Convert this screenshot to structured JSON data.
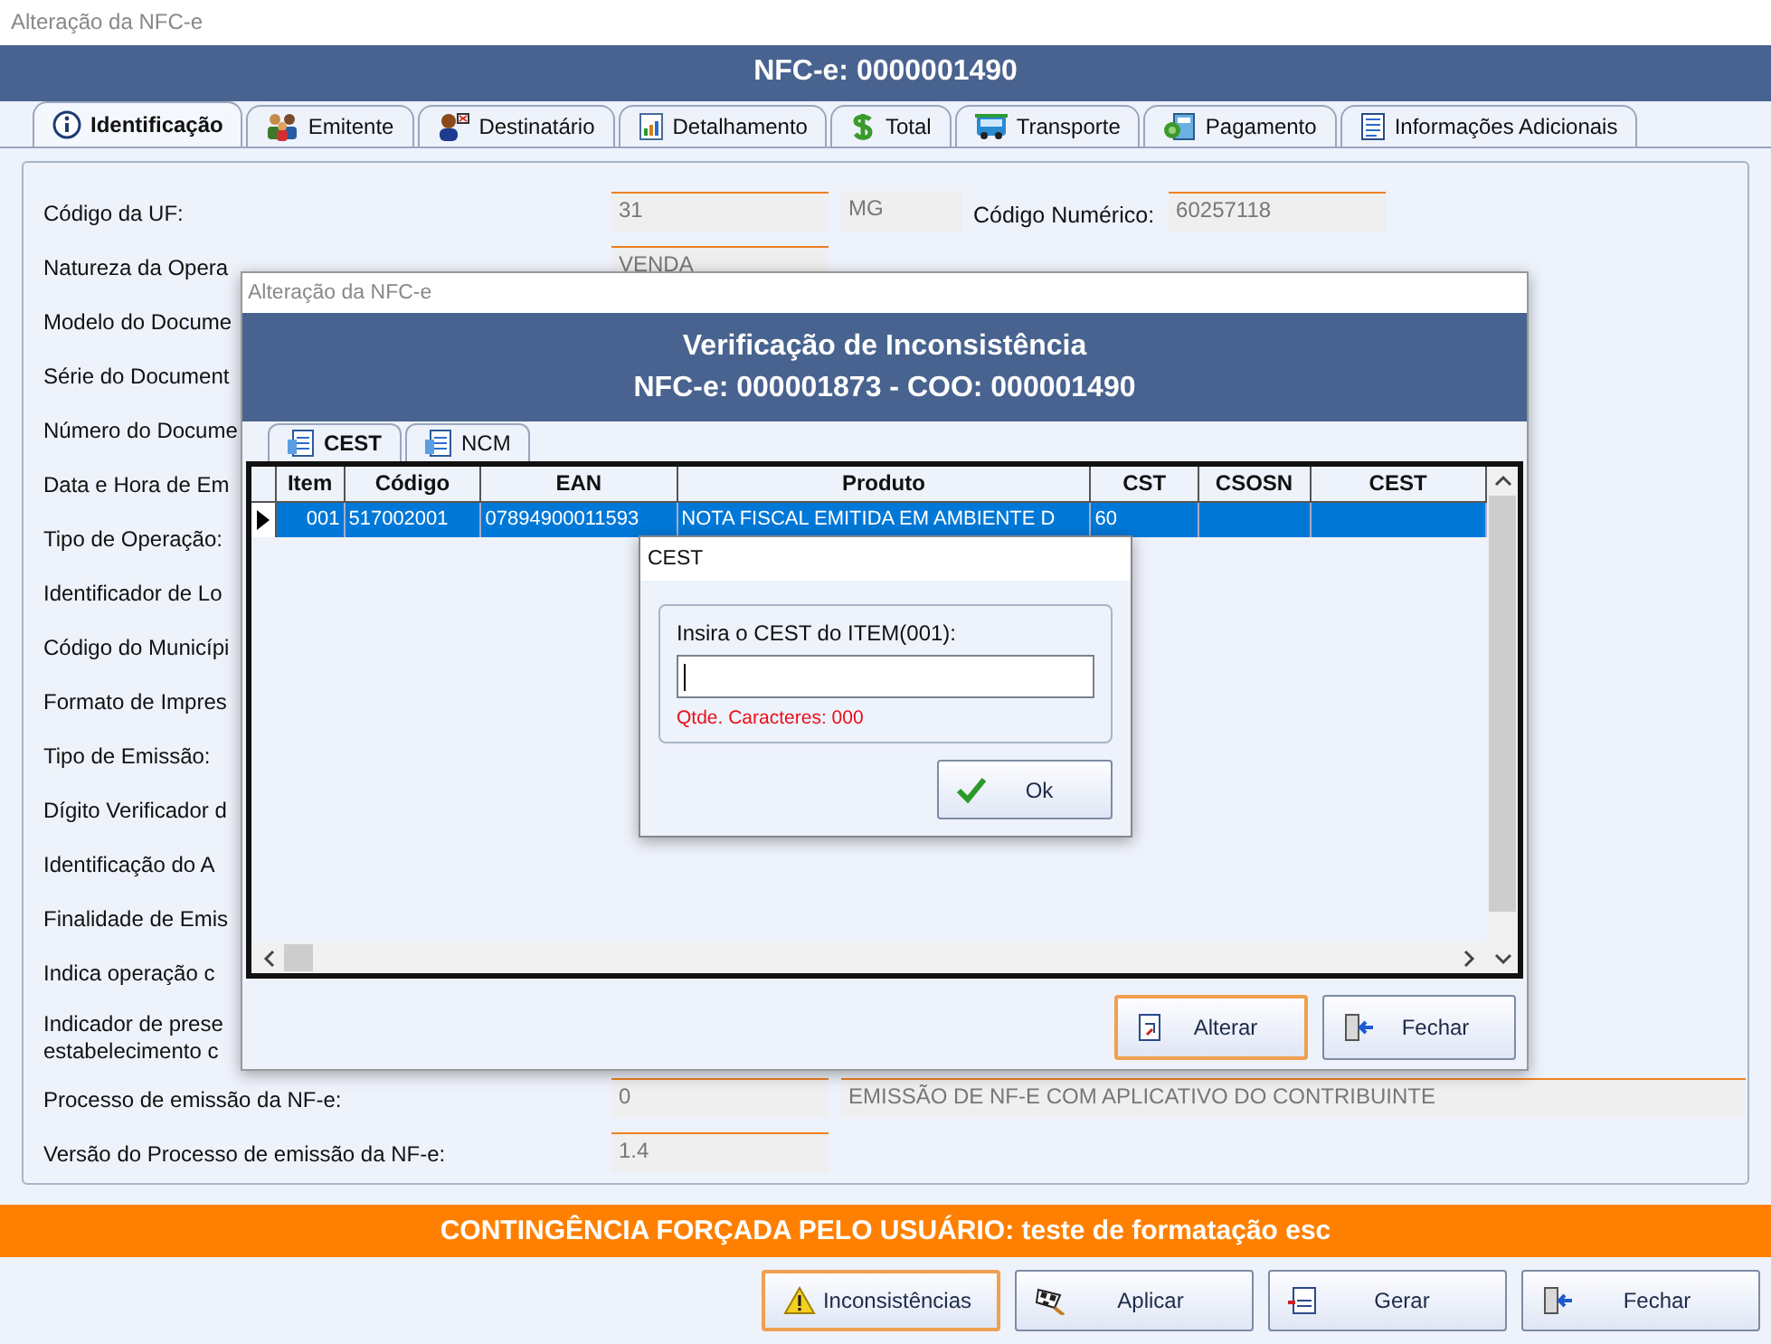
{
  "window": {
    "title": "Alteração da NFC-e"
  },
  "header": {
    "title": "NFC-e: 0000001490"
  },
  "tabs": [
    {
      "label": "Identificação",
      "selected": true
    },
    {
      "label": "Emitente",
      "selected": false
    },
    {
      "label": "Destinatário",
      "selected": false
    },
    {
      "label": "Detalhamento",
      "selected": false
    },
    {
      "label": "Total",
      "selected": false
    },
    {
      "label": "Transporte",
      "selected": false
    },
    {
      "label": "Pagamento",
      "selected": false
    },
    {
      "label": "Informações Adicionais",
      "selected": false
    }
  ],
  "form": {
    "rows": [
      {
        "label": "Código da UF:",
        "items": [
          {
            "kind": "field",
            "text": "31"
          },
          {
            "kind": "small",
            "text": "MG"
          },
          {
            "kind": "label",
            "text": "Código Numérico:"
          },
          {
            "kind": "field",
            "text": "60257118"
          }
        ]
      },
      {
        "label": "Natureza da Opera",
        "items": [
          {
            "kind": "field",
            "text": "VENDA"
          }
        ]
      },
      {
        "label": "Modelo do Docume"
      },
      {
        "label": "Série do Document"
      },
      {
        "label": "Número do Docume"
      },
      {
        "label": "Data e Hora de Em"
      },
      {
        "label": "Tipo de Operação:"
      },
      {
        "label": "Identificador de Lo"
      },
      {
        "label": "Código do Municípi"
      },
      {
        "label": "Formato de Impres"
      },
      {
        "label": "Tipo de Emissão:"
      },
      {
        "label": "Dígito Verificador d"
      },
      {
        "label": "Identificação do A"
      },
      {
        "label": "Finalidade de Emis"
      },
      {
        "label": "Indica operação c"
      },
      {
        "label": "Indicador de prese",
        "label_2": "estabelecimento c"
      },
      {
        "label": "Processo de emissão da NF-e:",
        "items": [
          {
            "kind": "field",
            "text": "0"
          },
          {
            "kind": "wide",
            "text": "EMISSÃO DE NF-E COM APLICATIVO DO CONTRIBUINTE"
          }
        ]
      },
      {
        "label": "Versão do Processo de emissão da NF-e:",
        "items": [
          {
            "kind": "field",
            "text": "1.4"
          }
        ]
      }
    ]
  },
  "dialog": {
    "title": "Alteração da NFC-e",
    "heading": "Verificação de Inconsistência",
    "subheading": "NFC-e: 000001873 - COO: 000001490",
    "tabs": [
      {
        "label": "CEST",
        "selected": true
      },
      {
        "label": "NCM",
        "selected": false
      }
    ],
    "table": {
      "columns": [
        "Item",
        "Código",
        "EAN",
        "Produto",
        "CST",
        "CSOSN",
        "CEST"
      ],
      "rows": [
        {
          "selected": true,
          "cells": [
            "001",
            "517002001",
            "07894900011593",
            "NOTA FISCAL EMITIDA EM AMBIENTE D",
            "60"
          ]
        }
      ]
    },
    "buttons": [
      {
        "label": "Alterar",
        "focused": true
      },
      {
        "label": "Fechar",
        "focused": false
      }
    ]
  },
  "prompt": {
    "title": "CEST",
    "label": "Insira o CEST do ITEM(001):",
    "counter": "Qtde. Caracteres: 000",
    "button": "Ok"
  },
  "banner": "CONTINGÊNCIA FORÇADA PELO USUÁRIO: teste de formatação esc",
  "buttons": [
    {
      "label": "Inconsistências",
      "focused": true
    },
    {
      "label": "Aplicar",
      "focused": false
    },
    {
      "label": "Gerar",
      "focused": false
    },
    {
      "label": "Fechar",
      "focused": false
    }
  ]
}
